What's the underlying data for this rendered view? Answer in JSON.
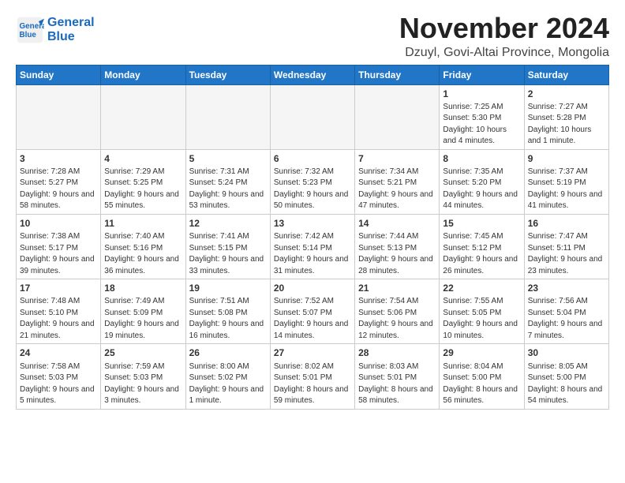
{
  "logo": {
    "line1": "General",
    "line2": "Blue"
  },
  "title": "November 2024",
  "subtitle": "Dzuyl, Govi-Altai Province, Mongolia",
  "weekdays": [
    "Sunday",
    "Monday",
    "Tuesday",
    "Wednesday",
    "Thursday",
    "Friday",
    "Saturday"
  ],
  "weeks": [
    [
      {
        "day": "",
        "info": ""
      },
      {
        "day": "",
        "info": ""
      },
      {
        "day": "",
        "info": ""
      },
      {
        "day": "",
        "info": ""
      },
      {
        "day": "",
        "info": ""
      },
      {
        "day": "1",
        "info": "Sunrise: 7:25 AM\nSunset: 5:30 PM\nDaylight: 10 hours and 4 minutes."
      },
      {
        "day": "2",
        "info": "Sunrise: 7:27 AM\nSunset: 5:28 PM\nDaylight: 10 hours and 1 minute."
      }
    ],
    [
      {
        "day": "3",
        "info": "Sunrise: 7:28 AM\nSunset: 5:27 PM\nDaylight: 9 hours and 58 minutes."
      },
      {
        "day": "4",
        "info": "Sunrise: 7:29 AM\nSunset: 5:25 PM\nDaylight: 9 hours and 55 minutes."
      },
      {
        "day": "5",
        "info": "Sunrise: 7:31 AM\nSunset: 5:24 PM\nDaylight: 9 hours and 53 minutes."
      },
      {
        "day": "6",
        "info": "Sunrise: 7:32 AM\nSunset: 5:23 PM\nDaylight: 9 hours and 50 minutes."
      },
      {
        "day": "7",
        "info": "Sunrise: 7:34 AM\nSunset: 5:21 PM\nDaylight: 9 hours and 47 minutes."
      },
      {
        "day": "8",
        "info": "Sunrise: 7:35 AM\nSunset: 5:20 PM\nDaylight: 9 hours and 44 minutes."
      },
      {
        "day": "9",
        "info": "Sunrise: 7:37 AM\nSunset: 5:19 PM\nDaylight: 9 hours and 41 minutes."
      }
    ],
    [
      {
        "day": "10",
        "info": "Sunrise: 7:38 AM\nSunset: 5:17 PM\nDaylight: 9 hours and 39 minutes."
      },
      {
        "day": "11",
        "info": "Sunrise: 7:40 AM\nSunset: 5:16 PM\nDaylight: 9 hours and 36 minutes."
      },
      {
        "day": "12",
        "info": "Sunrise: 7:41 AM\nSunset: 5:15 PM\nDaylight: 9 hours and 33 minutes."
      },
      {
        "day": "13",
        "info": "Sunrise: 7:42 AM\nSunset: 5:14 PM\nDaylight: 9 hours and 31 minutes."
      },
      {
        "day": "14",
        "info": "Sunrise: 7:44 AM\nSunset: 5:13 PM\nDaylight: 9 hours and 28 minutes."
      },
      {
        "day": "15",
        "info": "Sunrise: 7:45 AM\nSunset: 5:12 PM\nDaylight: 9 hours and 26 minutes."
      },
      {
        "day": "16",
        "info": "Sunrise: 7:47 AM\nSunset: 5:11 PM\nDaylight: 9 hours and 23 minutes."
      }
    ],
    [
      {
        "day": "17",
        "info": "Sunrise: 7:48 AM\nSunset: 5:10 PM\nDaylight: 9 hours and 21 minutes."
      },
      {
        "day": "18",
        "info": "Sunrise: 7:49 AM\nSunset: 5:09 PM\nDaylight: 9 hours and 19 minutes."
      },
      {
        "day": "19",
        "info": "Sunrise: 7:51 AM\nSunset: 5:08 PM\nDaylight: 9 hours and 16 minutes."
      },
      {
        "day": "20",
        "info": "Sunrise: 7:52 AM\nSunset: 5:07 PM\nDaylight: 9 hours and 14 minutes."
      },
      {
        "day": "21",
        "info": "Sunrise: 7:54 AM\nSunset: 5:06 PM\nDaylight: 9 hours and 12 minutes."
      },
      {
        "day": "22",
        "info": "Sunrise: 7:55 AM\nSunset: 5:05 PM\nDaylight: 9 hours and 10 minutes."
      },
      {
        "day": "23",
        "info": "Sunrise: 7:56 AM\nSunset: 5:04 PM\nDaylight: 9 hours and 7 minutes."
      }
    ],
    [
      {
        "day": "24",
        "info": "Sunrise: 7:58 AM\nSunset: 5:03 PM\nDaylight: 9 hours and 5 minutes."
      },
      {
        "day": "25",
        "info": "Sunrise: 7:59 AM\nSunset: 5:03 PM\nDaylight: 9 hours and 3 minutes."
      },
      {
        "day": "26",
        "info": "Sunrise: 8:00 AM\nSunset: 5:02 PM\nDaylight: 9 hours and 1 minute."
      },
      {
        "day": "27",
        "info": "Sunrise: 8:02 AM\nSunset: 5:01 PM\nDaylight: 8 hours and 59 minutes."
      },
      {
        "day": "28",
        "info": "Sunrise: 8:03 AM\nSunset: 5:01 PM\nDaylight: 8 hours and 58 minutes."
      },
      {
        "day": "29",
        "info": "Sunrise: 8:04 AM\nSunset: 5:00 PM\nDaylight: 8 hours and 56 minutes."
      },
      {
        "day": "30",
        "info": "Sunrise: 8:05 AM\nSunset: 5:00 PM\nDaylight: 8 hours and 54 minutes."
      }
    ]
  ]
}
